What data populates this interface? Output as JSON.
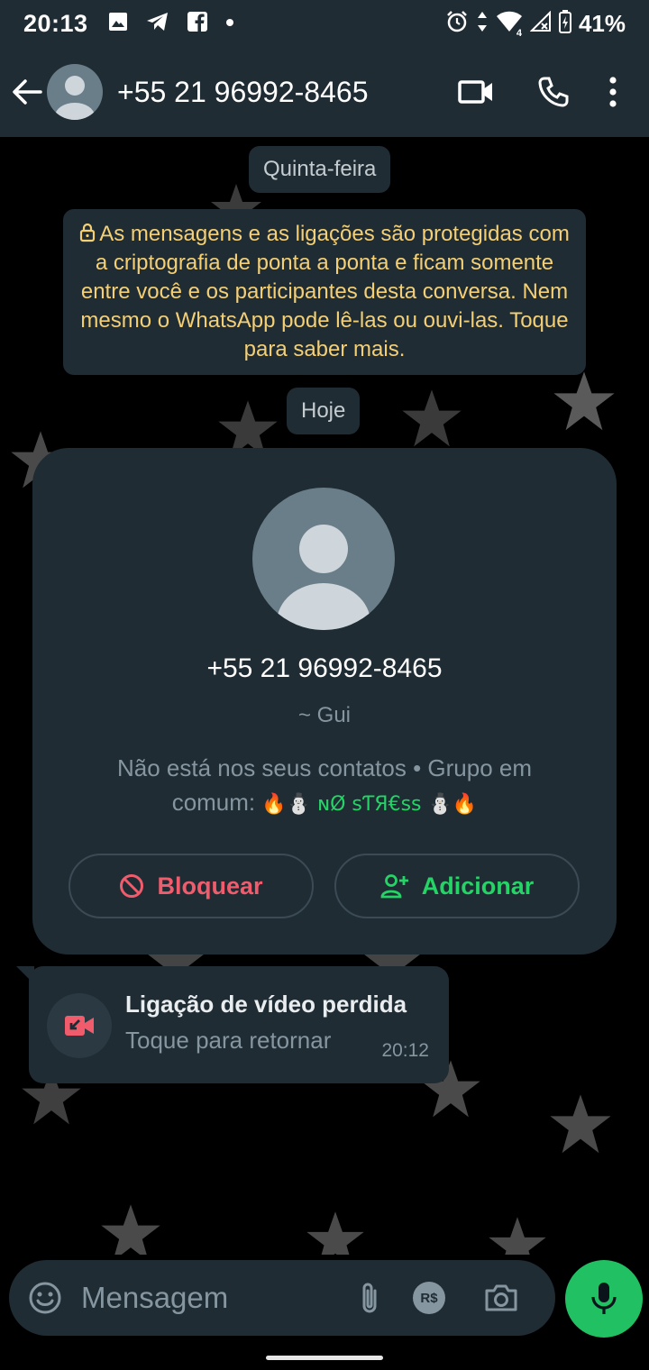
{
  "status_bar": {
    "time": "20:13",
    "battery": "41%",
    "network_badge": "4"
  },
  "header": {
    "contact": "+55 21 96992-8465"
  },
  "chat": {
    "date_label_1": "Quinta-feira",
    "encryption_notice": "As mensagens e as ligações são protegidas com a criptografia de ponta a ponta e ficam somente entre você e os participantes desta conversa. Nem mesmo o WhatsApp pode lê-las ou ouvi-las. Toque para saber mais.",
    "date_label_2": "Hoje"
  },
  "contact_card": {
    "phone": "+55 21 96992-8465",
    "nickname": "~ Gui",
    "info_prefix": "Não está nos seus contatos • Grupo em comum: ",
    "group_name": "🔥⛄ ɴØ ꜱƬЯ€ꜱꜱ ⛄🔥",
    "block_label": "Bloquear",
    "add_label": "Adicionar"
  },
  "missed_call": {
    "title": "Ligação de vídeo perdida",
    "subtitle": "Toque para retornar",
    "time": "20:12"
  },
  "composer": {
    "placeholder": "Mensagem",
    "currency_label": "R$"
  },
  "colors": {
    "bar_bg": "#1f2c34",
    "accent_green": "#25d366",
    "danger_red": "#f15c6d",
    "notice_yellow": "#f4cf74"
  }
}
